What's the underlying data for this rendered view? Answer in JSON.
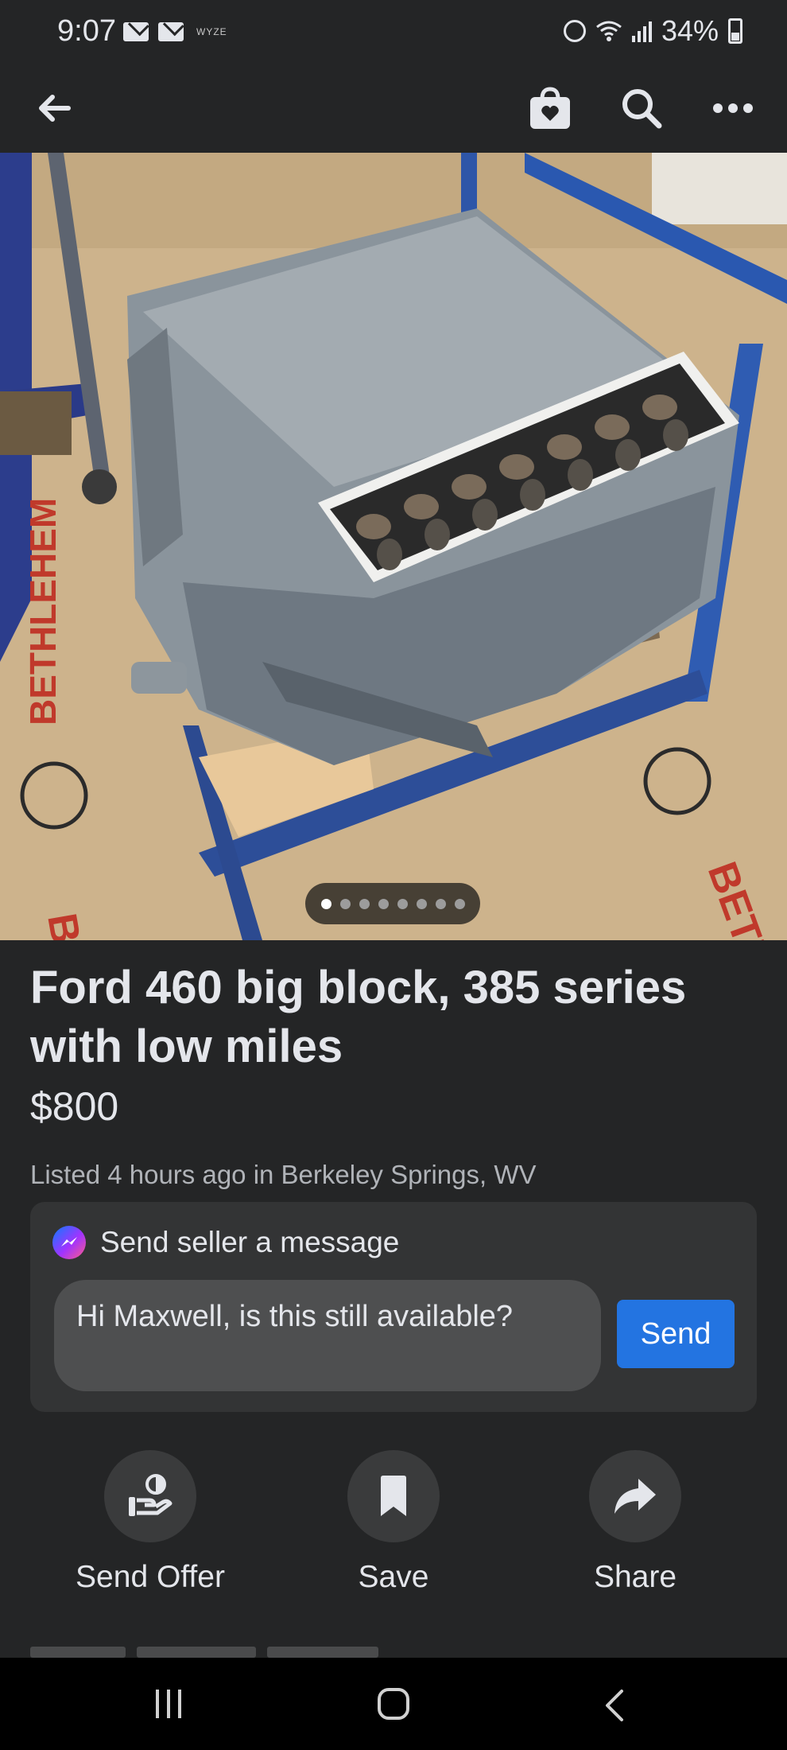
{
  "status_bar": {
    "time": "9:07",
    "wyze_label": "WYZE",
    "battery": "34%"
  },
  "nav": {
    "icons": [
      "back-arrow-icon",
      "marketplace-bag-icon",
      "search-icon",
      "more-icon"
    ]
  },
  "carousel": {
    "total_images": 8,
    "active_index": 0
  },
  "listing": {
    "title": "Ford 460 big block, 385 series with low miles",
    "price": "$800",
    "listed": "Listed 4 hours ago in Berkeley Springs, WV"
  },
  "message": {
    "header": "Send seller a message",
    "input_value": "Hi Maxwell, is this still available?",
    "send_label": "Send"
  },
  "actions": [
    {
      "label": "Send Offer",
      "icon": "send-offer-icon"
    },
    {
      "label": "Save",
      "icon": "bookmark-icon"
    },
    {
      "label": "Share",
      "icon": "share-icon"
    }
  ],
  "colors": {
    "background": "#242526",
    "card": "#333435",
    "accent": "#2374e1",
    "text": "#e4e6eb",
    "muted": "#b0b3b8"
  }
}
